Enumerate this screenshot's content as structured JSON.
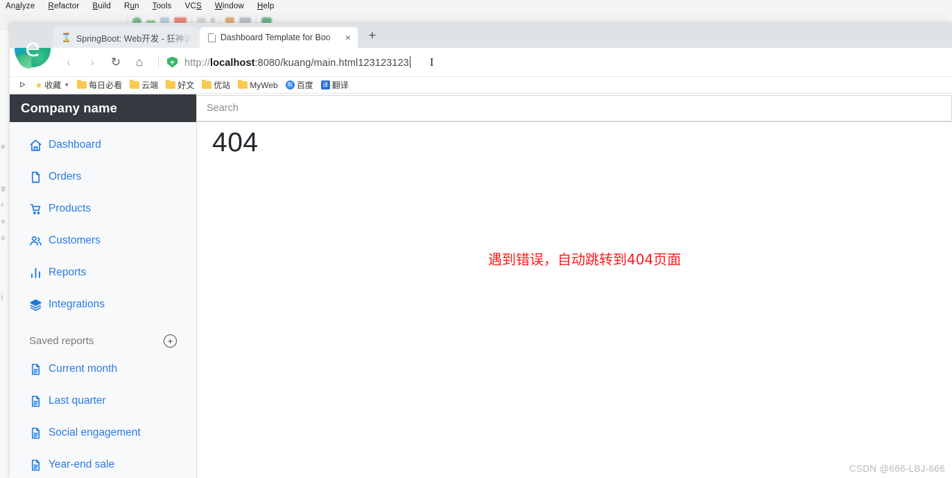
{
  "ide": {
    "menu": [
      "Analyze",
      "Refactor",
      "Build",
      "Run",
      "Tools",
      "VCS",
      "Window",
      "Help"
    ],
    "gutter_fragments": [
      "e",
      "g",
      "r",
      "n",
      "o",
      "l"
    ]
  },
  "browser": {
    "tabs": [
      {
        "label": "SpringBoot: Web开发 - 狂神说",
        "icon": "spring-leaf-icon",
        "active": false
      },
      {
        "label": "Dashboard Template for Boo",
        "icon": "page-icon",
        "active": true
      }
    ],
    "new_tab_label": "+",
    "close_label": "×",
    "nav": {
      "back": "‹",
      "forward": "›",
      "reload": "↻",
      "home": "⌂"
    },
    "url": {
      "scheme": "http://",
      "host": "localhost",
      "rest": ":8080/kuang/main.html123123123",
      "full": "http://localhost:8080/kuang/main.html123123123"
    },
    "bookmarks": [
      {
        "label": "收藏",
        "icon": "star-icon",
        "has_chevron": true
      },
      {
        "label": "每日必看",
        "icon": "folder-icon"
      },
      {
        "label": "云端",
        "icon": "folder-icon"
      },
      {
        "label": "好文",
        "icon": "folder-icon"
      },
      {
        "label": "优站",
        "icon": "folder-icon"
      },
      {
        "label": "MyWeb",
        "icon": "folder-icon"
      },
      {
        "label": "百度",
        "icon": "baidu-icon"
      },
      {
        "label": "翻译",
        "icon": "translate-icon"
      }
    ],
    "bookmark_expand": "ᐅ"
  },
  "app": {
    "brand": "Company name",
    "search": {
      "value": "",
      "placeholder": "Search"
    },
    "nav_items": [
      {
        "label": "Dashboard",
        "icon": "home-icon"
      },
      {
        "label": "Orders",
        "icon": "file-icon"
      },
      {
        "label": "Products",
        "icon": "cart-icon"
      },
      {
        "label": "Customers",
        "icon": "users-icon"
      },
      {
        "label": "Reports",
        "icon": "bar-chart-icon"
      },
      {
        "label": "Integrations",
        "icon": "layers-icon"
      }
    ],
    "saved_reports": {
      "title": "Saved reports",
      "add_label": "+",
      "items": [
        {
          "label": "Current month",
          "icon": "document-icon"
        },
        {
          "label": "Last quarter",
          "icon": "document-icon"
        },
        {
          "label": "Social engagement",
          "icon": "document-icon"
        },
        {
          "label": "Year-end sale",
          "icon": "document-icon"
        }
      ]
    },
    "content": {
      "status_code": "404",
      "error_message": "遇到错误，自动跳转到404页面",
      "error_color": "#ff1a1a"
    }
  },
  "watermark": "CSDN @666-LBJ-666",
  "colors": {
    "brand_bar": "#343a40",
    "sidebar_bg": "#f8f9fa",
    "link_blue": "#2a7ae4",
    "error_red": "#ff1a1a"
  }
}
